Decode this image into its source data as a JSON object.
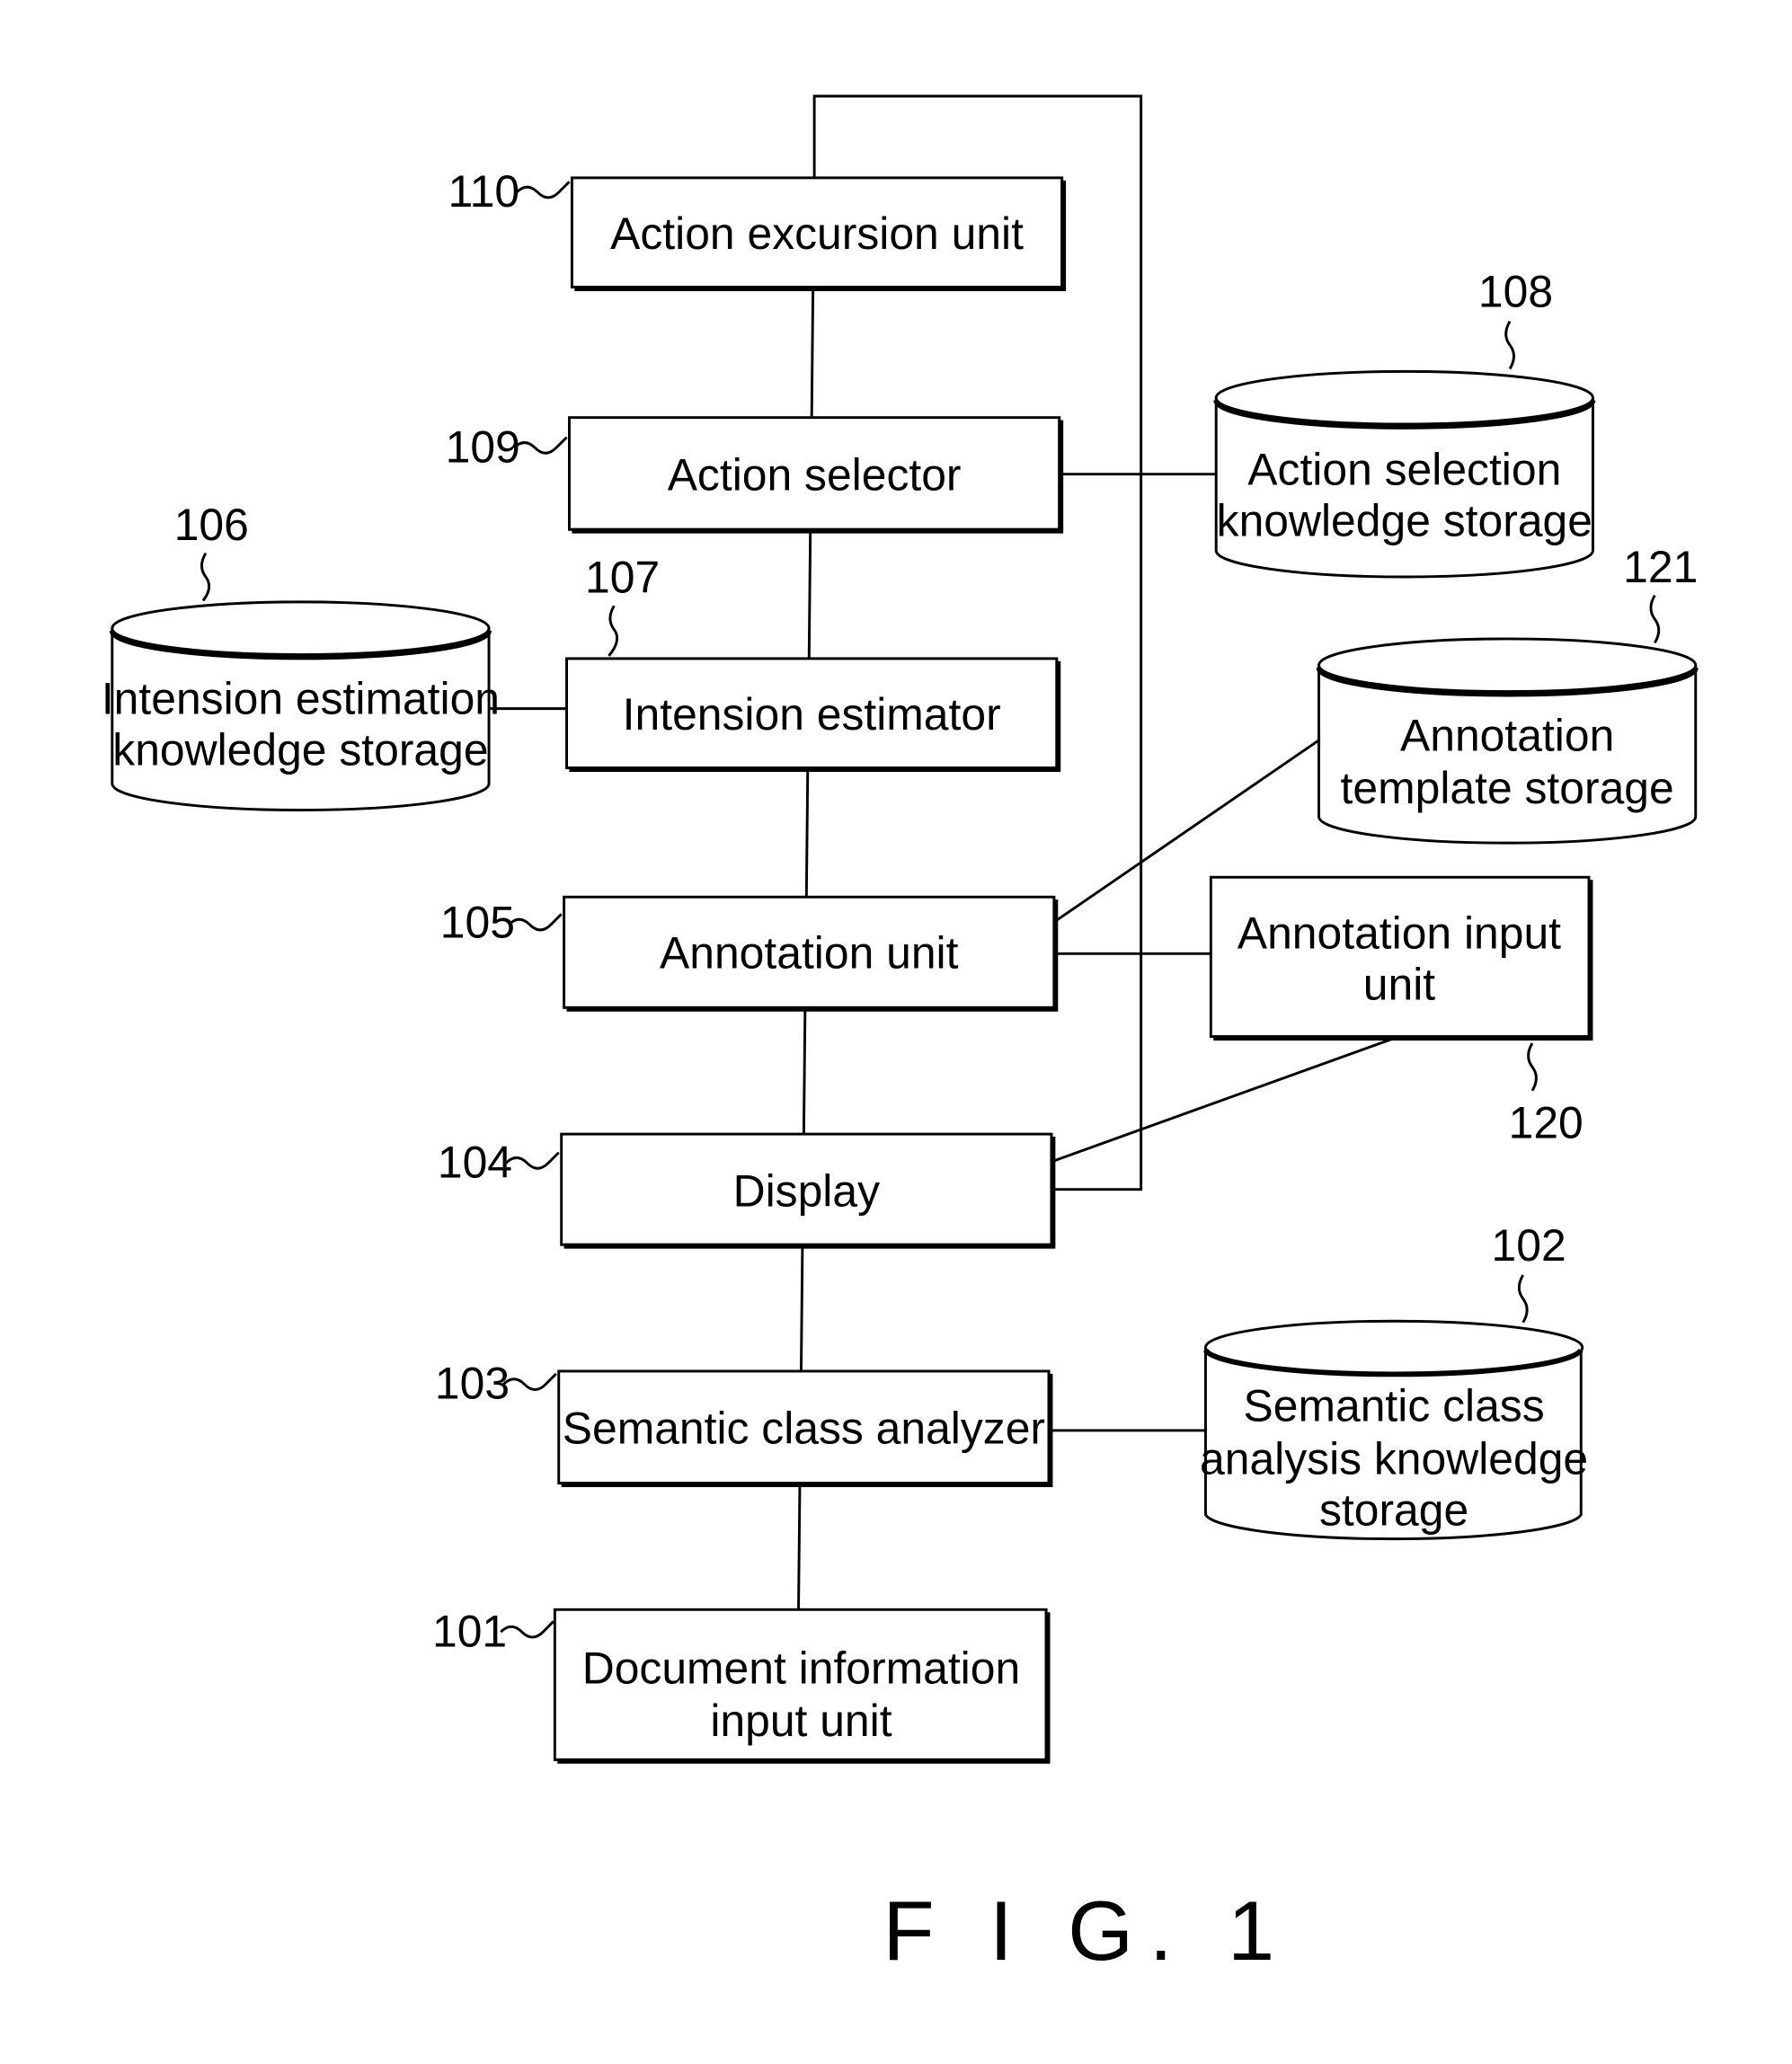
{
  "figure": {
    "caption": "F I G. 1",
    "units": {
      "110": {
        "ref": "110",
        "lines": [
          "Action excursion unit"
        ]
      },
      "109": {
        "ref": "109",
        "lines": [
          "Action selector"
        ]
      },
      "107": {
        "ref": "107",
        "lines": [
          "Intension estimator"
        ]
      },
      "105": {
        "ref": "105",
        "lines": [
          "Annotation unit"
        ]
      },
      "104": {
        "ref": "104",
        "lines": [
          "Display"
        ]
      },
      "103": {
        "ref": "103",
        "lines": [
          "Semantic class analyzer"
        ]
      },
      "101": {
        "ref": "101",
        "lines": [
          "Document information",
          "input unit"
        ]
      },
      "120": {
        "ref": "120",
        "lines": [
          "Annotation input",
          "unit"
        ]
      }
    },
    "storages": {
      "108": {
        "ref": "108",
        "lines": [
          "Action selection",
          "knowledge storage"
        ]
      },
      "106": {
        "ref": "106",
        "lines": [
          "Intension estimation",
          "knowledge storage"
        ]
      },
      "121": {
        "ref": "121",
        "lines": [
          "Annotation",
          "template storage"
        ]
      },
      "102": {
        "ref": "102",
        "lines": [
          "Semantic class",
          "analysis knowledge",
          "storage"
        ]
      }
    }
  }
}
